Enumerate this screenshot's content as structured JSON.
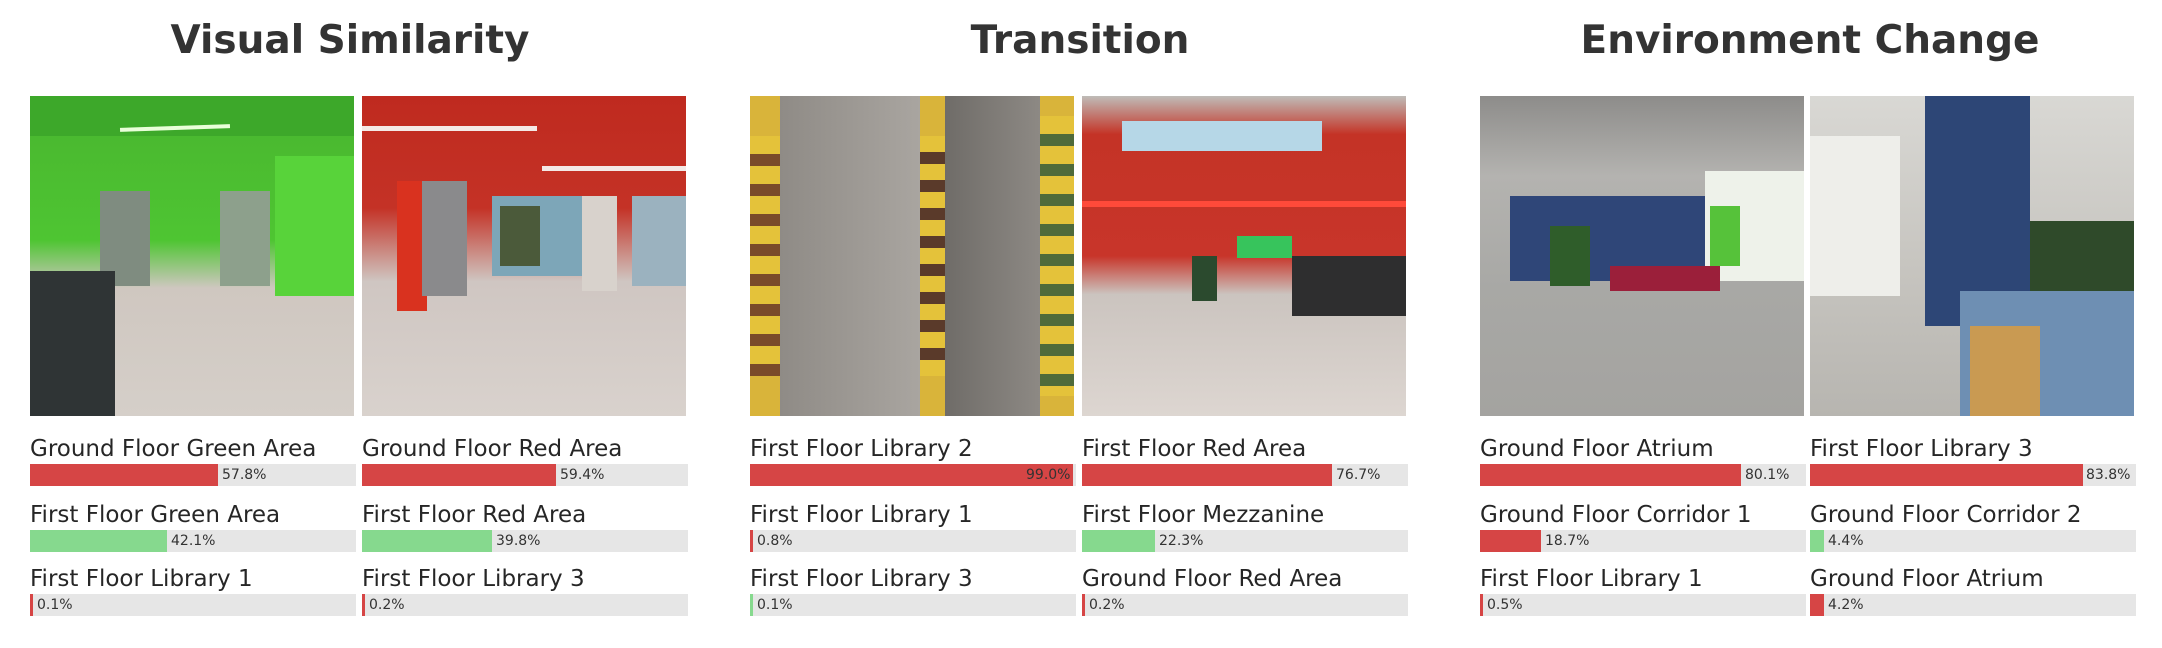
{
  "colors": {
    "fill_red": "#d64545",
    "fill_green": "#86d98e",
    "track": "#e6e6e6",
    "title": "#333333"
  },
  "sections": [
    {
      "title": "Visual Similarity",
      "columns": [
        {
          "photo_scene": "green corridor with elevators",
          "predictions": [
            {
              "label": "Ground Floor Green Area",
              "value": "57.8%",
              "fraction": 0.578,
              "color": "red"
            },
            {
              "label": "First Floor Green Area",
              "value": "42.1%",
              "fraction": 0.421,
              "color": "green"
            },
            {
              "label": "First Floor Library 1",
              "value": "0.1%",
              "fraction": 0.001,
              "color": "red"
            }
          ]
        },
        {
          "photo_scene": "red hall with elevator and bookshelves",
          "predictions": [
            {
              "label": "Ground Floor Red Area",
              "value": "59.4%",
              "fraction": 0.594,
              "color": "red"
            },
            {
              "label": "First Floor Red Area",
              "value": "39.8%",
              "fraction": 0.398,
              "color": "green"
            },
            {
              "label": "First Floor Library 3",
              "value": "0.2%",
              "fraction": 0.002,
              "color": "red"
            }
          ]
        }
      ]
    },
    {
      "title": "Transition",
      "columns": [
        {
          "photo_scene": "library pillars and yellow bookshelves",
          "predictions": [
            {
              "label": "First Floor Library 2",
              "value": "99.0%",
              "fraction": 0.99,
              "color": "red"
            },
            {
              "label": "First Floor Library 1",
              "value": "0.8%",
              "fraction": 0.008,
              "color": "red"
            },
            {
              "label": "First Floor Library 3",
              "value": "0.1%",
              "fraction": 0.001,
              "color": "green"
            }
          ]
        },
        {
          "photo_scene": "red wall with reception desk",
          "predictions": [
            {
              "label": "First Floor Red Area",
              "value": "76.7%",
              "fraction": 0.767,
              "color": "red"
            },
            {
              "label": "First Floor Mezzanine",
              "value": "22.3%",
              "fraction": 0.223,
              "color": "green"
            },
            {
              "label": "Ground Floor Red Area",
              "value": "0.2%",
              "fraction": 0.002,
              "color": "red"
            }
          ]
        }
      ]
    },
    {
      "title": "Environment Change",
      "columns": [
        {
          "photo_scene": "atrium with blue wall and red sofas",
          "predictions": [
            {
              "label": "Ground Floor Atrium",
              "value": "80.1%",
              "fraction": 0.801,
              "color": "red"
            },
            {
              "label": "Ground Floor Corridor 1",
              "value": "18.7%",
              "fraction": 0.187,
              "color": "red"
            },
            {
              "label": "First Floor Library 1",
              "value": "0.5%",
              "fraction": 0.005,
              "color": "red"
            }
          ]
        },
        {
          "photo_scene": "blue pillar with wooden table",
          "predictions": [
            {
              "label": "First Floor Library 3",
              "value": "83.8%",
              "fraction": 0.838,
              "color": "red"
            },
            {
              "label": "Ground Floor Corridor 2",
              "value": "4.4%",
              "fraction": 0.044,
              "color": "green"
            },
            {
              "label": "Ground Floor Atrium",
              "value": "4.2%",
              "fraction": 0.042,
              "color": "red"
            }
          ]
        }
      ]
    }
  ]
}
